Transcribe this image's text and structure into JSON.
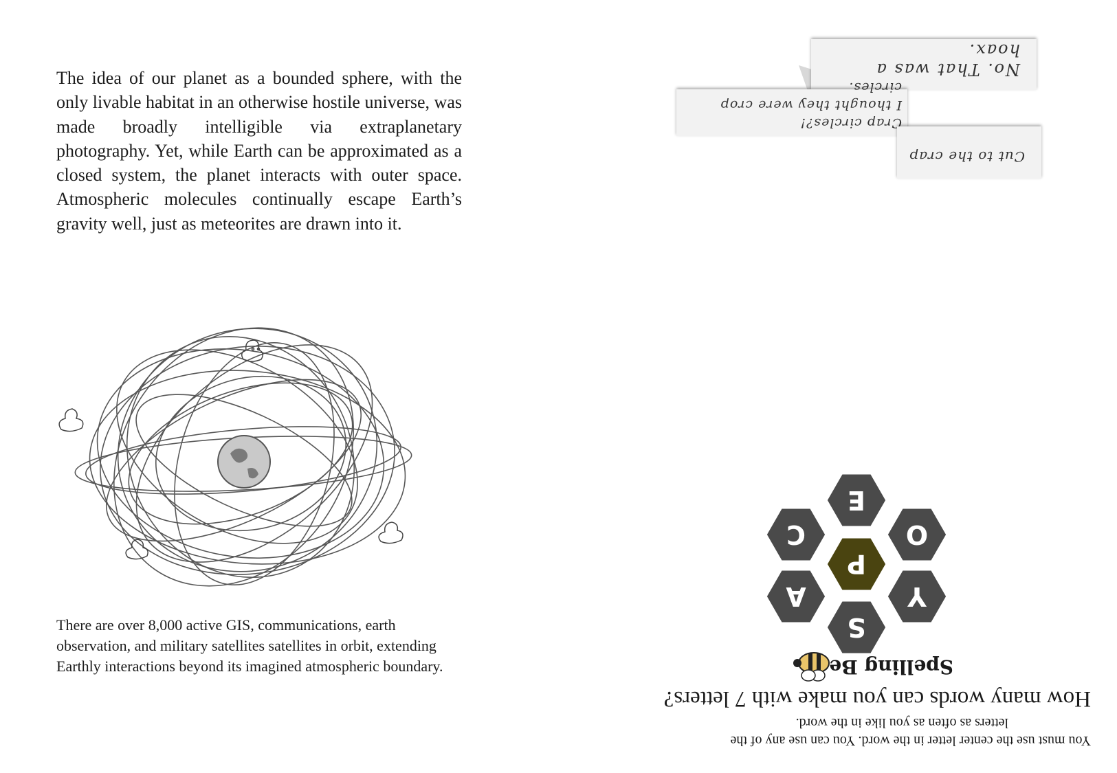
{
  "left_page": {
    "intro_paragraph": "The idea of our planet as a bounded sphere, with the only livable habitat in an otherwise hostile universe, was made broadly intelligible via extraplanetary photography. Yet, while Earth can be approximated as a closed system, the planet interacts with outer space. Atmospheric molecules continually escape Earth’s gravity well, just as meteorites are drawn into it.",
    "caption": "There are over 8,000 active GIS, communications, earth observation, and military satellites satellites in orbit, extending Earthly interactions beyond its imagined atmospheric boundary."
  },
  "right_page": {
    "notes": {
      "hoax": "No. That was a hoax.",
      "crop_circles_line1": "Crap circles?!",
      "crop_circles_line2": "I thought they were crop circles.",
      "cut_to_crap": "Cut to the crap"
    },
    "spelling_bee": {
      "title": "Spelling Bee",
      "question": "How many words can you make with 7 letters?",
      "rules_line1": "You must use the center letter in the word. You can use any of the",
      "rules_line2": "letters as often as you like in the word.",
      "center_letter": "P",
      "outer_letters": [
        "E",
        "O",
        "Y",
        "S",
        "A",
        "C"
      ],
      "colors": {
        "hex": "#4a4a4a",
        "center": "#4a4410",
        "border": "#ffffff"
      }
    }
  }
}
